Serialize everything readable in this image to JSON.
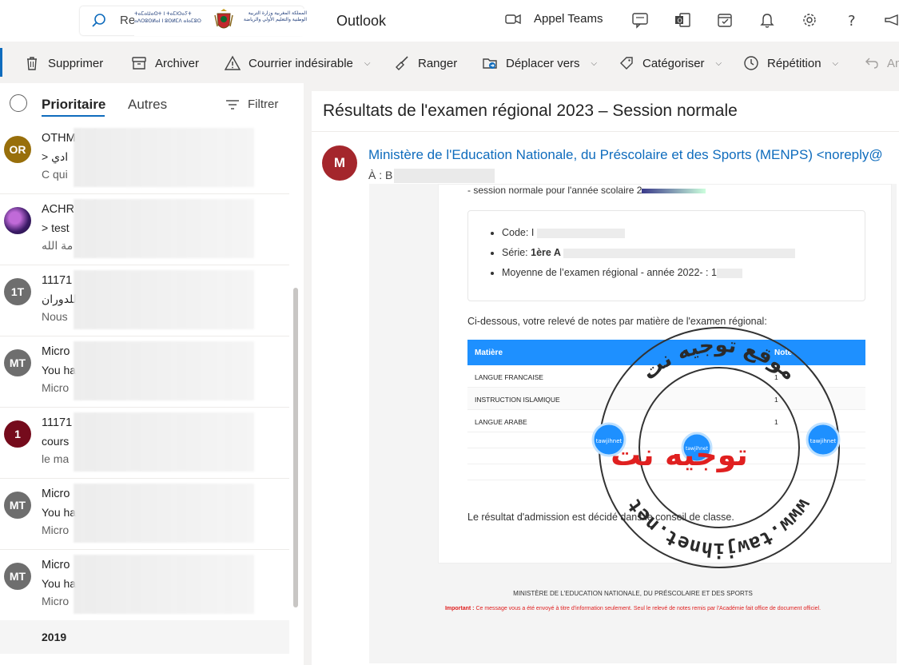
{
  "header": {
    "search_text": "Re",
    "app_title": "Outlook",
    "teams_label": "Appel Teams",
    "logo_text_latin": "ⵜⴰⵎⴰⵡⴰⵙⵜ ⵏ ⵜⴰⵎⵏⵔⴰⵢⵜ ⴰⴷⵔⵓⵙⵍⴰⵏ ⵏ ⵓⵙⵍⵎⴷ ⴰⵏⴰⵎⵓⵔ",
    "logo_text_arabic": "المملكة المغربية وزارة التربية الوطنية والتعليم الأولي والرياضة"
  },
  "ribbon": {
    "delete": "Supprimer",
    "archive": "Archiver",
    "junk": "Courrier indésirable",
    "sweep": "Ranger",
    "move": "Déplacer vers",
    "categorize": "Catégoriser",
    "snooze": "Répétition",
    "undo": "An"
  },
  "list": {
    "tab_focused": "Prioritaire",
    "tab_other": "Autres",
    "filter": "Filtrer",
    "year_label": "2019",
    "messages": [
      {
        "initials": "OR",
        "color": "#986f0b",
        "line1": "OTHM",
        "line2": "> ادي",
        "line3": "C qui"
      },
      {
        "initials": "",
        "color": "#5a2d82",
        "line1": "ACHR",
        "line2": "> test",
        "line3": "مة الله"
      },
      {
        "initials": "1T",
        "color": "#6e6e6e",
        "line1": "11171",
        "line2": "للدوران",
        "line3": "Nous"
      },
      {
        "initials": "MT",
        "color": "#6e6e6e",
        "line1": "Micro",
        "line2": "You ha",
        "line3": "Micro"
      },
      {
        "initials": "1",
        "color": "#750b1c",
        "line1": "11171",
        "line2": "cours",
        "line3": "le ma"
      },
      {
        "initials": "MT",
        "color": "#6e6e6e",
        "line1": "Micro",
        "line2": "You ha",
        "line3": "Micro"
      },
      {
        "initials": "MT",
        "color": "#6e6e6e",
        "line1": "Micro",
        "line2": "You ha",
        "line3": "Micro"
      }
    ]
  },
  "reading": {
    "subject": "Résultats de l'examen régional 2023 – Session normale",
    "sender_initial": "M",
    "sender": "Ministère de l'Education Nationale, du Préscolaire et des Sports (MENPS) <noreply@",
    "to_label": "À :  B",
    "intro": "- session normale pour l'année scolaire 2",
    "code_label": "Code: I",
    "serie_label": "Série: ",
    "serie_value": "1ère A",
    "moyenne_label": "Moyenne de l’examen régional - année 2022- : 1",
    "releve": "Ci-dessous, votre relevé de notes par matière de l'examen régional:",
    "table_head_subject": "Matière",
    "table_head_note": "Note",
    "rows": [
      {
        "subject": "LANGUE FRANCAISE",
        "note": "1"
      },
      {
        "subject": "INSTRUCTION ISLAMIQUE",
        "note": "1"
      },
      {
        "subject": "LANGUE ARABE",
        "note": "1"
      }
    ],
    "result": "Le résultat d'admission est décidé dans le conseil de classe.",
    "footer_ministry": "MINISTÈRE DE L'EDUCATION NATIONALE, DU PRÉSCOLAIRE ET DES SPORTS",
    "footer_important_label": "Important :",
    "footer_important": " Ce message vous a été envoyé à titre d'information seulement. Seul le relevé de notes remis par l'Académie fait office de document officiel."
  },
  "watermark": {
    "arabic_top": "موقع توجيه نت",
    "brand": "توجيه نت",
    "url_text": "www.tawjihnet.net",
    "badge_text": "tawjihnet",
    "accent": "#e02020",
    "blue": "#1e90ff"
  }
}
